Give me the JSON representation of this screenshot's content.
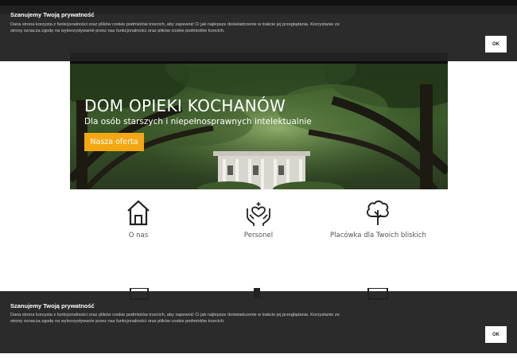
{
  "header": {
    "phone": ""
  },
  "hero": {
    "title": "DOM OPIEKI KOCHANÓW",
    "subtitle": "Dla osób starszych i niepełnosprawnych intelektualnie",
    "cta_label": "Nasza oferta"
  },
  "features": [
    {
      "label": "O nas",
      "icon": "house-icon"
    },
    {
      "label": "Personel",
      "icon": "caring-hands-icon"
    },
    {
      "label": "Placówka dla Twoich bliskich",
      "icon": "tree-icon"
    }
  ],
  "cookie_top": {
    "title": "Szanujemy Twoją prywatność",
    "text": "Dana strona korzysta z funkcjonalności oraz plików cookie podmiotów trzecich, aby zapewnić Ci jak najlepsze doświadczenie w trakcie jej przeglądania. Korzystanie ze strony oznacza zgodę na wykorzystywanie przez nas funkcjonalności oraz plików cookie podmiotów trzecich.",
    "ok_label": "OK"
  },
  "cookie_bottom": {
    "title": "Szanujemy Twoją prywatność",
    "text": "Dana strona korzysta z funkcjonalności oraz plików cookie podmiotów trzecich, aby zapewnić Ci jak najlepsze doświadczenie w trakcie jej przeglądania. Korzystanie ze strony oznacza zgodę na wykorzystywanie przez nas funkcjonalności oraz plików cookie podmiotów trzecich.",
    "ok_label": "OK"
  },
  "colors": {
    "accent": "#f3a712",
    "banner": "#222222",
    "hero_green": "#2f4a22"
  }
}
